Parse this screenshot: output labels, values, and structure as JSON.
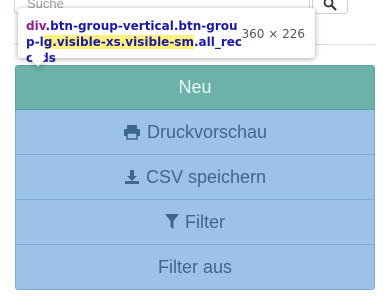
{
  "search": {
    "placeholder": "Suche"
  },
  "tooltip": {
    "tag": "div",
    "selector_before": ".btn-group-vertical.btn-group-l",
    "selector_line2_hl": "g.visible-xs.visible-sm",
    "selector_after": ".all_records",
    "size": "360 × 226"
  },
  "buttons": {
    "new_label": "Neu",
    "print_label": "Druckvorschau",
    "csv_label": "CSV speichern",
    "filter_label": "Filter",
    "filter_off_label": "Filter aus"
  },
  "colors": {
    "primary": "#6cb2aa",
    "button_bg": "#9dc2e8",
    "button_text": "#3f678e"
  },
  "icons": {
    "search": "search-icon",
    "print": "print-icon",
    "download": "download-icon",
    "filter": "filter-icon"
  }
}
